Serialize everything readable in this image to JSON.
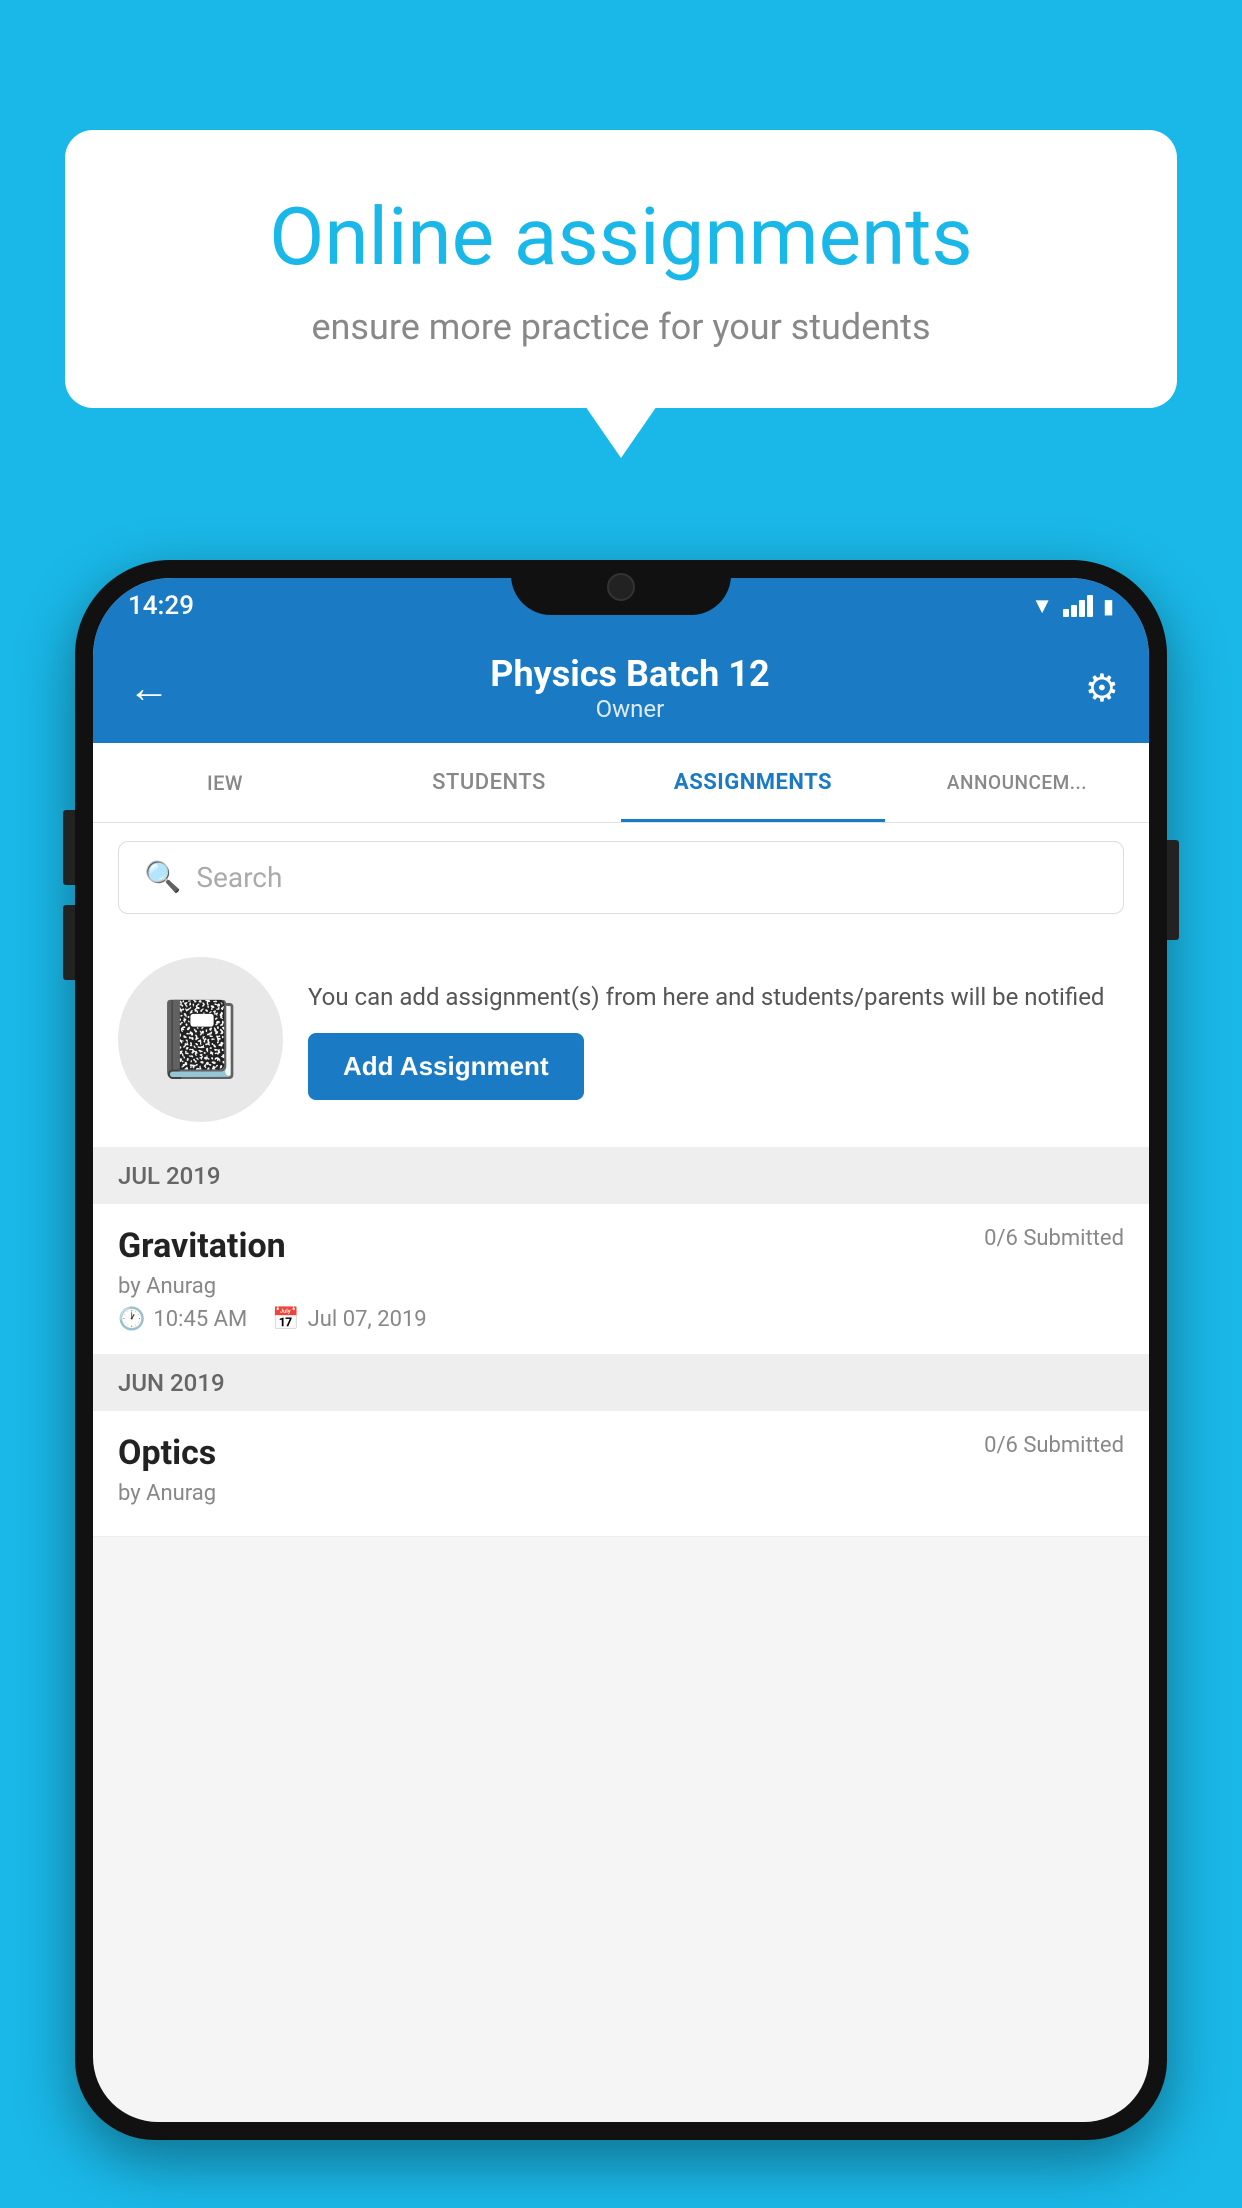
{
  "background_color": "#1ab8e8",
  "bubble": {
    "title": "Online assignments",
    "subtitle": "ensure more practice for your students"
  },
  "status_bar": {
    "time": "14:29",
    "wifi": "▼▲",
    "battery": "🔋"
  },
  "header": {
    "title": "Physics Batch 12",
    "subtitle": "Owner",
    "back_label": "←",
    "settings_label": "⚙"
  },
  "tabs": [
    {
      "id": "view",
      "label": "IEW"
    },
    {
      "id": "students",
      "label": "STUDENTS"
    },
    {
      "id": "assignments",
      "label": "ASSIGNMENTS",
      "active": true
    },
    {
      "id": "announcements",
      "label": "ANNOUNCEM..."
    }
  ],
  "search": {
    "placeholder": "Search"
  },
  "promo": {
    "description": "You can add assignment(s) from here and students/parents will be notified",
    "button_label": "Add Assignment"
  },
  "sections": [
    {
      "label": "JUL 2019",
      "assignments": [
        {
          "name": "Gravitation",
          "submitted": "0/6 Submitted",
          "by": "by Anurag",
          "time": "10:45 AM",
          "date": "Jul 07, 2019"
        }
      ]
    },
    {
      "label": "JUN 2019",
      "assignments": [
        {
          "name": "Optics",
          "submitted": "0/6 Submitted",
          "by": "by Anurag",
          "time": "",
          "date": ""
        }
      ]
    }
  ]
}
